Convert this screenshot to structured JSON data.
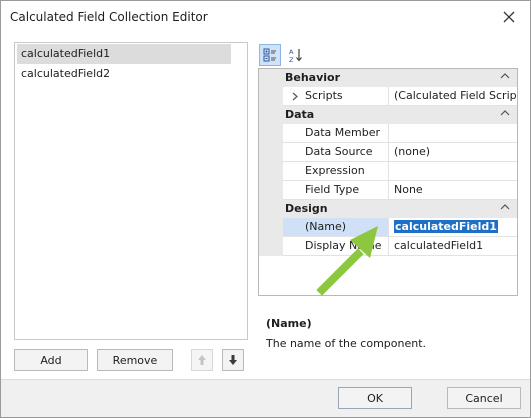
{
  "window": {
    "title": "Calculated Field Collection Editor"
  },
  "list": {
    "items": [
      "calculatedField1",
      "calculatedField2"
    ]
  },
  "list_buttons": {
    "add": "Add",
    "remove": "Remove"
  },
  "property_grid": {
    "categories": [
      {
        "name": "Behavior",
        "properties": [
          {
            "name": "Scripts",
            "value": "(Calculated Field Scripts)"
          }
        ]
      },
      {
        "name": "Data",
        "properties": [
          {
            "name": "Data Member",
            "value": ""
          },
          {
            "name": "Data Source",
            "value": "(none)"
          },
          {
            "name": "Expression",
            "value": ""
          },
          {
            "name": "Field Type",
            "value": "None"
          }
        ]
      },
      {
        "name": "Design",
        "properties": [
          {
            "name": "(Name)",
            "value": "calculatedField1"
          },
          {
            "name": "Display Name",
            "value": "calculatedField1"
          }
        ]
      }
    ]
  },
  "description": {
    "title": "(Name)",
    "text": "The name of the component."
  },
  "footer": {
    "ok": "OK",
    "cancel": "Cancel"
  },
  "colors": {
    "selection": "#1f6fc5",
    "arrow": "#8dc63f",
    "category_bg": "#e9e9e9"
  }
}
